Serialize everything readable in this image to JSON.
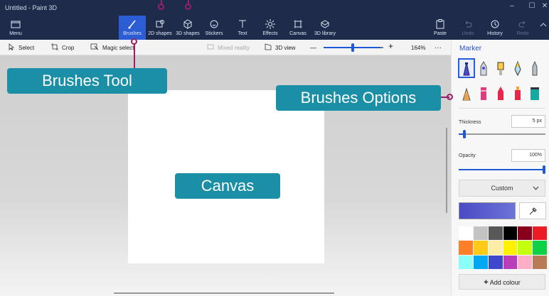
{
  "window": {
    "title": "Untitled - Paint 3D",
    "controls": [
      "–",
      "☐",
      "✕"
    ]
  },
  "menu": {
    "label": "Menu"
  },
  "tools": [
    {
      "label": "Brushes",
      "icon": "brush-icon",
      "active": true
    },
    {
      "label": "2D shapes",
      "icon": "shapes-2d-icon"
    },
    {
      "label": "3D shapes",
      "icon": "cube-icon"
    },
    {
      "label": "Stickers",
      "icon": "sticker-icon"
    },
    {
      "label": "Text",
      "icon": "text-icon"
    },
    {
      "label": "Effects",
      "icon": "sun-icon"
    },
    {
      "label": "Canvas",
      "icon": "canvas-icon"
    },
    {
      "label": "3D library",
      "icon": "library-icon"
    }
  ],
  "right_tools": [
    {
      "label": "Paste",
      "icon": "paste-icon"
    },
    {
      "label": "Undo",
      "icon": "undo-icon",
      "disabled": true
    },
    {
      "label": "History",
      "icon": "history-icon"
    },
    {
      "label": "Redo",
      "icon": "redo-icon",
      "disabled": true
    }
  ],
  "subbar": {
    "select": "Select",
    "crop": "Crop",
    "magic_select": "Magic select",
    "mixed_reality": "Mixed reality",
    "view_3d": "3D view",
    "zoom_minus": "—",
    "zoom_plus": "+",
    "zoom_level": "164%",
    "more": "···",
    "zoom_fraction": 0.5
  },
  "panel": {
    "title": "Marker",
    "brushes": [
      "marker",
      "calligraphy-pen",
      "oil-brush",
      "watercolor",
      "pencil",
      "eraser",
      "crayon",
      "pixel-pen",
      "spray-can",
      "fill"
    ],
    "thickness_label": "Thickness",
    "thickness_value": "5 px",
    "thickness_fraction": 0.05,
    "opacity_label": "Opacity",
    "opacity_value": "100%",
    "opacity_fraction": 1.0,
    "dropdown_value": "Custom",
    "add_colour": "Add colour",
    "current_color": "#4a4ac4",
    "swatches": [
      "#ffffff",
      "#c3c3c3",
      "#585858",
      "#000000",
      "#88001b",
      "#ec1c24",
      "#ff7f27",
      "#ffca18",
      "#fdeca6",
      "#fff200",
      "#c4ff0e",
      "#0ed145",
      "#8cfffb",
      "#00a8f3",
      "#3f48cc",
      "#b83dba",
      "#ffaec8",
      "#b97a56"
    ]
  },
  "callouts": {
    "brushes_tool": "Brushes Tool",
    "brushes_options": "Brushes Options",
    "canvas": "Canvas"
  },
  "colors": {
    "accent": "#2c5dd4",
    "callout": "#1b8fa6",
    "leader": "#9a1f6a"
  }
}
